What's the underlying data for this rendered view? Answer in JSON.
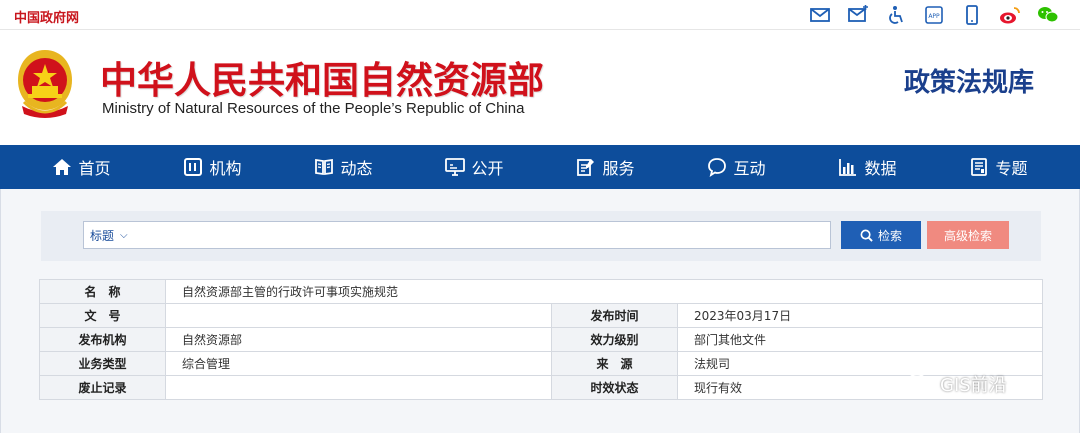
{
  "topbar": {
    "gov_link": "中国政府网",
    "icons": [
      "mail-icon",
      "mail-send-icon",
      "accessibility-icon",
      "app-icon",
      "mobile-icon",
      "weibo-icon",
      "wechat-icon"
    ],
    "app_label": "APP"
  },
  "header": {
    "title_cn": "中华人民共和国自然资源部",
    "title_en": "Ministry of Natural Resources of the People’s Republic of China",
    "library_title": "政策法规库"
  },
  "nav": {
    "items": [
      {
        "label": "首页",
        "icon": "home-icon"
      },
      {
        "label": "机构",
        "icon": "org-icon"
      },
      {
        "label": "动态",
        "icon": "book-icon"
      },
      {
        "label": "公开",
        "icon": "monitor-icon"
      },
      {
        "label": "服务",
        "icon": "edit-doc-icon"
      },
      {
        "label": "互动",
        "icon": "chat-icon"
      },
      {
        "label": "数据",
        "icon": "bar-chart-icon"
      },
      {
        "label": "专题",
        "icon": "topic-icon"
      }
    ]
  },
  "search": {
    "field_type": "标题",
    "value": "",
    "search_label": "检索",
    "advanced_label": "高级检索"
  },
  "document": {
    "name_label": "名　称",
    "name_value": "自然资源部主管的行政许可事项实施规范",
    "doc_no_label": "文　号",
    "doc_no_value": "",
    "pub_date_label": "发布时间",
    "pub_date_value": "2023年03月17日",
    "issuer_label": "发布机构",
    "issuer_value": "自然资源部",
    "level_label": "效力级别",
    "level_value": "部门其他文件",
    "biz_type_label": "业务类型",
    "biz_type_value": "综合管理",
    "source_label": "来　源",
    "source_value": "法规司",
    "abolish_label": "废止记录",
    "abolish_value": "",
    "status_label": "时效状态",
    "status_value": "现行有效"
  },
  "watermark": {
    "text": "GIS前沿"
  },
  "colors": {
    "brand_red": "#d0111b",
    "nav_blue": "#0d4d9b",
    "search_blue": "#1f5fb5",
    "advanced_pink": "#f08a80",
    "library_title_blue": "#1a3f8c"
  }
}
